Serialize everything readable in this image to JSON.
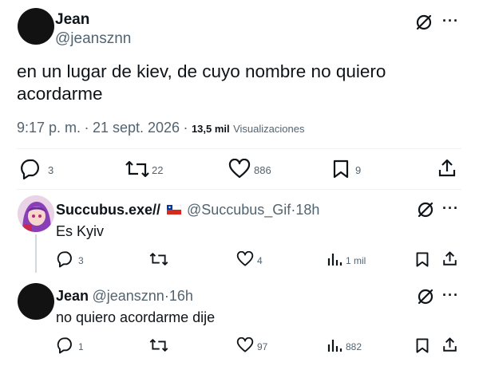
{
  "main_tweet": {
    "author_name": "Jean",
    "author_handle": "@jeansznn",
    "text_line1": "en un lugar de kiev, de cuyo nombre no quiero",
    "text_line2": "acordarme",
    "time": "9:17 p. m.",
    "dot1": "·",
    "date": "21 sept. 2026",
    "dot2": "·",
    "views_count": "13,5 mil",
    "views_label": "Visualizaciones",
    "more": "···",
    "actions": {
      "replies": "3",
      "retweets": "22",
      "likes": "886",
      "bookmarks": "9"
    },
    "icons": [
      "grok-icon",
      "more-icon",
      "reply-icon",
      "retweet-icon",
      "like-icon",
      "bookmark-icon",
      "share-icon"
    ]
  },
  "reply1": {
    "author_name": "Succubus.exe//",
    "flag": "Chile flag",
    "author_handle": "@Succubus_Gif",
    "dot": "·",
    "time": "18h",
    "text": "Es Kyiv",
    "more": "···",
    "actions": {
      "replies": "3",
      "retweets": "",
      "likes": "4",
      "views": "1 mil"
    }
  },
  "reply2": {
    "author_name": "Jean",
    "author_handle": "@jeansznn",
    "dot": "·",
    "time": "16h",
    "text": "no quiero acordarme dije",
    "more": "···",
    "actions": {
      "replies": "1",
      "retweets": "",
      "likes": "97",
      "views": "882"
    }
  },
  "colors": {
    "text": "#0f1419",
    "secondary": "#536471",
    "divider": "#eff3f4",
    "thread_line": "#cfd9de",
    "flag_red": "#d52b1e",
    "flag_blue": "#0039a6"
  }
}
